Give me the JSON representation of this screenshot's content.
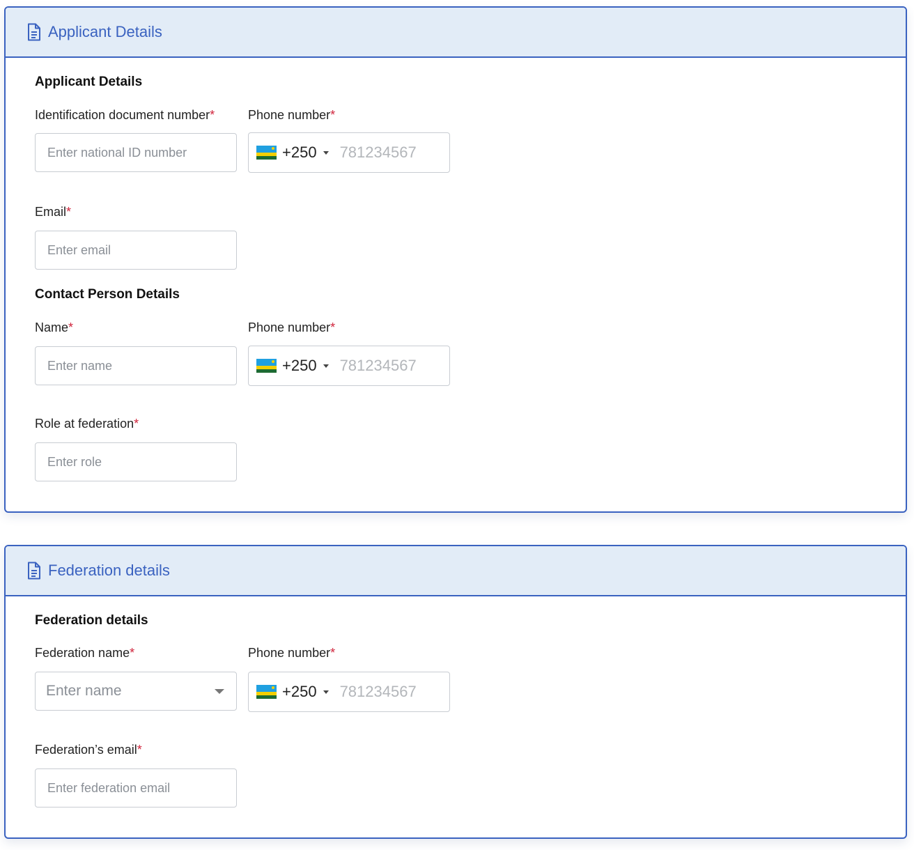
{
  "colors": {
    "accent": "#3a62c0",
    "header_bg": "#e2ecf7",
    "required": "#d0243c",
    "flag_blue": "#20a0e0",
    "flag_yellow": "#f4d000",
    "flag_green": "#1e6b32"
  },
  "icons": {
    "header": "document-icon",
    "flag": "rwanda-flag-icon",
    "dropdown": "caret-down-icon"
  },
  "applicant_card": {
    "header_title": "Applicant Details",
    "applicant_section": {
      "title": "Applicant Details",
      "id_label": "Identification document number",
      "id_placeholder": "Enter national ID number",
      "phone_label": "Phone number",
      "phone_code": "+250",
      "phone_placeholder": "781234567",
      "email_label": "Email",
      "email_placeholder": "Enter email"
    },
    "contact_section": {
      "title": "Contact Person Details",
      "name_label": "Name",
      "name_placeholder": "Enter name",
      "phone_label": "Phone number",
      "phone_code": "+250",
      "phone_placeholder": "781234567",
      "role_label": "Role at federation",
      "role_placeholder": "Enter role"
    }
  },
  "federation_card": {
    "header_title": "Federation details",
    "section": {
      "title": "Federation details",
      "name_label": "Federation name",
      "name_placeholder": "Enter name",
      "phone_label": "Phone number",
      "phone_code": "+250",
      "phone_placeholder": "781234567",
      "email_label": "Federation’s email",
      "email_placeholder": "Enter federation email"
    }
  },
  "required_marker": "*"
}
